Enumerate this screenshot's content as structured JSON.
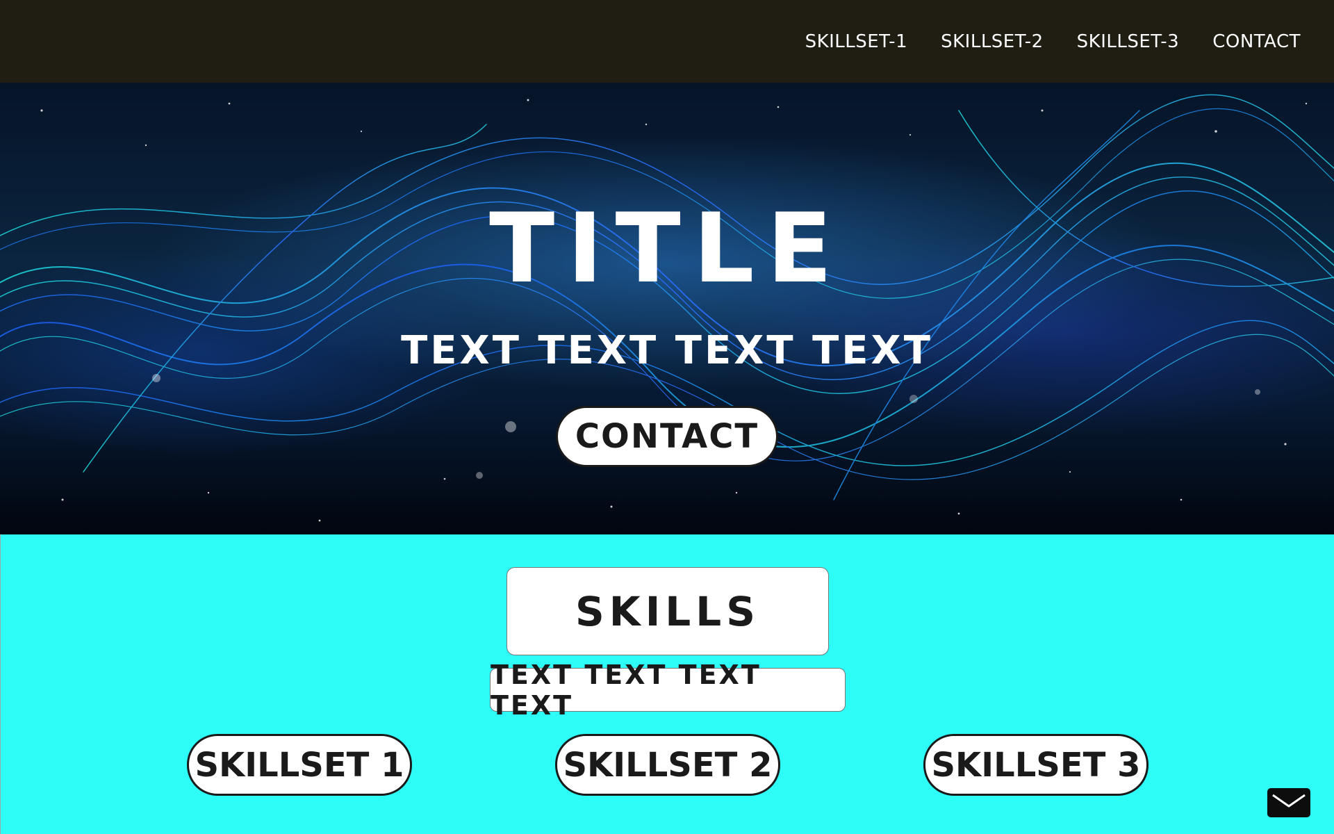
{
  "nav": {
    "links": [
      "SKILLSET-1",
      "SKILLSET-2",
      "SKILLSET-3",
      "CONTACT"
    ]
  },
  "hero": {
    "title": "TITLE",
    "subtitle": "TEXT TEXT TEXT TEXT",
    "contact_label": "CONTACT"
  },
  "skills": {
    "heading": "SKILLS",
    "subtext": "TEXT TEXT TEXT TEXT",
    "buttons": [
      "SKILLSET 1",
      "SKILLSET 2",
      "SKILLSET 3"
    ]
  },
  "icons": {
    "mail": "envelope-icon"
  },
  "colors": {
    "nav_bg": "#201d13",
    "skills_bg": "#2efdf7",
    "button_bg": "#ffffff",
    "text_dark": "#1a1a1a"
  }
}
